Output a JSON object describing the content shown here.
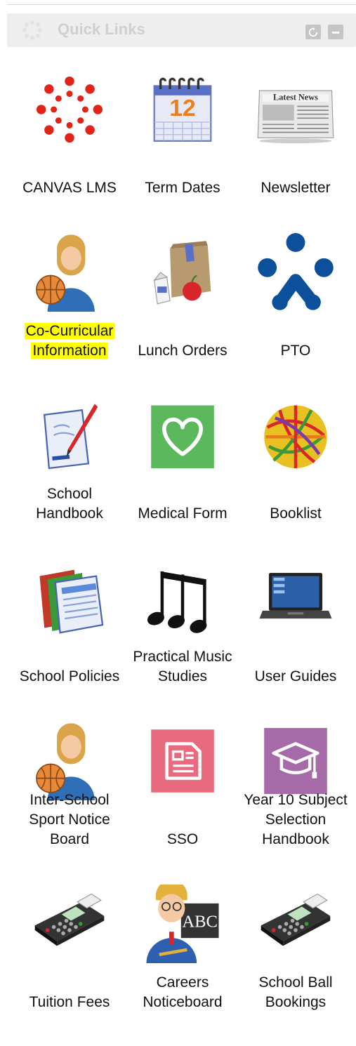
{
  "widget": {
    "title": "Quick Links",
    "spinner_icon": "loading-spinner-icon",
    "refresh_icon": "refresh-icon",
    "minimize_icon": "minimize-icon"
  },
  "links": [
    {
      "label": "CANVAS LMS",
      "icon": "canvas-logo-icon"
    },
    {
      "label": "Term Dates",
      "icon": "calendar-icon"
    },
    {
      "label": "Newsletter",
      "icon": "newspaper-icon"
    },
    {
      "label": "Co-Curricular Information",
      "icon": "student-basketball-icon",
      "highlight_color": "#ffff00"
    },
    {
      "label": "Lunch Orders",
      "icon": "lunch-bag-icon"
    },
    {
      "label": "PTO",
      "icon": "pto-logo-icon"
    },
    {
      "label": "School Handbook",
      "icon": "document-pen-icon"
    },
    {
      "label": "Medical Form",
      "icon": "heart-icon"
    },
    {
      "label": "Booklist",
      "icon": "rubber-band-ball-icon"
    },
    {
      "label": "School Policies",
      "icon": "folders-icon"
    },
    {
      "label": "Practical Music Studies",
      "icon": "music-notes-icon"
    },
    {
      "label": "User Guides",
      "icon": "laptop-icon"
    },
    {
      "label": "Inter-School Sport Notice Board",
      "icon": "student-basketball-icon"
    },
    {
      "label": "SSO",
      "icon": "form-icon"
    },
    {
      "label": "Year 10 Subject Selection Handbook",
      "icon": "graduation-cap-icon"
    },
    {
      "label": "Tuition Fees",
      "icon": "payment-terminal-icon"
    },
    {
      "label": "Careers Noticeboard",
      "icon": "teacher-abc-icon"
    },
    {
      "label": "School Ball Bookings",
      "icon": "payment-terminal-icon"
    }
  ],
  "colors": {
    "canvas_red": "#e2231a",
    "pto_blue": "#0c4f9b",
    "medical_green": "#5cb85c",
    "sso_pink": "#e86a7f",
    "grad_purple": "#a66aa8"
  }
}
